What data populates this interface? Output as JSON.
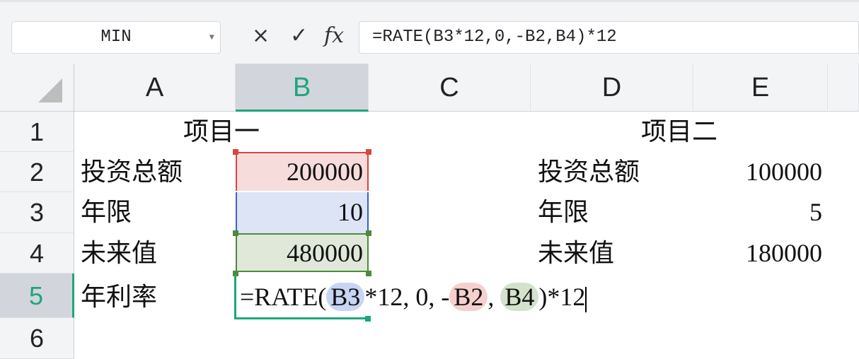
{
  "name_box": {
    "value": "MIN"
  },
  "formula_bar": {
    "cancel_icon": "×",
    "enter_icon": "✓",
    "fx_label": "fx",
    "value": "=RATE(B3*12,0,-B2,B4)*12"
  },
  "columns": [
    "A",
    "B",
    "C",
    "D",
    "E"
  ],
  "rows": [
    "1",
    "2",
    "3",
    "4",
    "5",
    "6"
  ],
  "cells": {
    "A1": "项目一",
    "D1": "项目二",
    "A2": "投资总额",
    "B2": "200000",
    "D2": "投资总额",
    "E2": "100000",
    "A3": "年限",
    "B3": "10",
    "D3": "年限",
    "E3": "5",
    "A4": "未来值",
    "B4": "480000",
    "D4": "未来值",
    "E4": "180000",
    "A5": "年利率"
  },
  "edit_formula": {
    "p1": "=RATE(",
    "ref1": "B3",
    "p2": "*12, 0, -",
    "ref2": "B2",
    "p3": ",",
    "ref3": "B4",
    "p4": ")*12"
  },
  "colors": {
    "ref_b2": "#d9453f",
    "ref_b3": "#3a63c9",
    "ref_b4": "#4f8a3a",
    "accent": "#1fa67a"
  }
}
